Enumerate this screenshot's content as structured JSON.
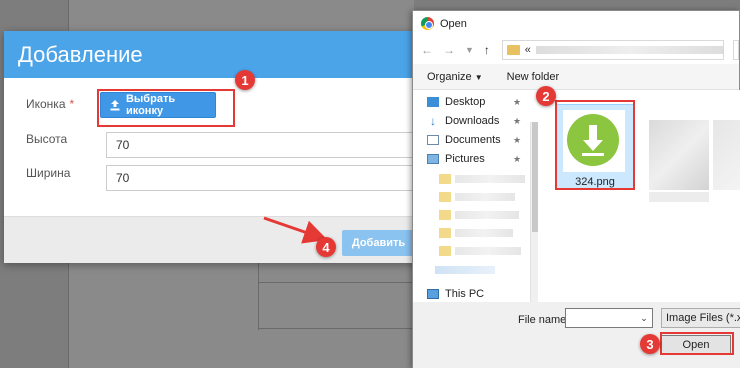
{
  "modal": {
    "title": "Добавление",
    "icon_label": "Иконка",
    "required_mark": "*",
    "choose_icon_button": "Выбрать иконку",
    "height_label": "Высота",
    "height_value": "70",
    "width_label": "Ширина",
    "width_value": "70",
    "add_button": "Добавить"
  },
  "dialog": {
    "title": "Open",
    "address_prefix": "«",
    "toolbar": {
      "organize": "Organize",
      "new_folder": "New folder"
    },
    "nav_items": [
      {
        "label": "Desktop",
        "icon": "desktop-icon"
      },
      {
        "label": "Downloads",
        "icon": "download-arrow-icon"
      },
      {
        "label": "Documents",
        "icon": "documents-icon"
      },
      {
        "label": "Pictures",
        "icon": "pictures-icon"
      }
    ],
    "this_pc": "This PC",
    "file": {
      "name": "324.png",
      "icon": "download-arrow-icon",
      "icon_color": "#8cc53f"
    },
    "file_name_label": "File name:",
    "file_name_value": "",
    "file_type": "Image Files (*.xbm",
    "open_button": "Open"
  },
  "annotations": {
    "steps": [
      "1",
      "2",
      "3",
      "4"
    ],
    "color": "#e53935"
  }
}
